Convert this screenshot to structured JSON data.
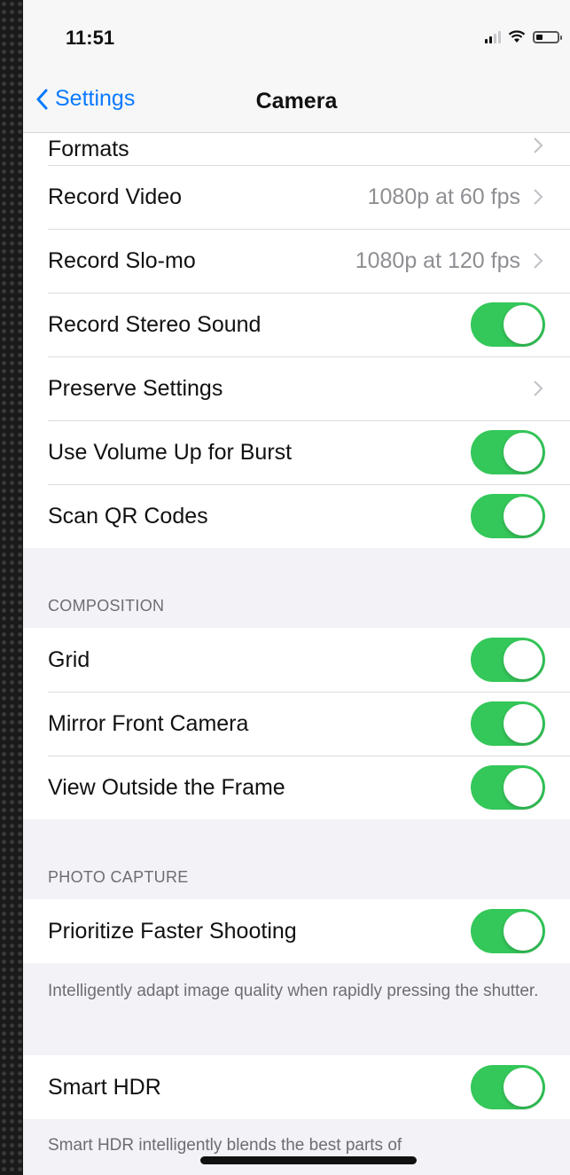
{
  "status_bar": {
    "time": "11:51"
  },
  "nav": {
    "back_label": "Settings",
    "title": "Camera"
  },
  "main_group": [
    {
      "label": "Formats",
      "value": "",
      "control": "chevron"
    },
    {
      "label": "Record Video",
      "value": "1080p at 60 fps",
      "control": "chevron"
    },
    {
      "label": "Record Slo-mo",
      "value": "1080p at 120 fps",
      "control": "chevron"
    },
    {
      "label": "Record Stereo Sound",
      "value": "",
      "control": "toggle",
      "on": true
    },
    {
      "label": "Preserve Settings",
      "value": "",
      "control": "chevron"
    },
    {
      "label": "Use Volume Up for Burst",
      "value": "",
      "control": "toggle",
      "on": true
    },
    {
      "label": "Scan QR Codes",
      "value": "",
      "control": "toggle",
      "on": true
    }
  ],
  "composition": {
    "header": "COMPOSITION",
    "items": [
      {
        "label": "Grid",
        "on": true
      },
      {
        "label": "Mirror Front Camera",
        "on": true
      },
      {
        "label": "View Outside the Frame",
        "on": true
      }
    ]
  },
  "photo_capture": {
    "header": "PHOTO CAPTURE",
    "prioritize_label": "Prioritize Faster Shooting",
    "prioritize_on": true,
    "prioritize_note": "Intelligently adapt image quality when rapidly pressing the shutter.",
    "smart_hdr_label": "Smart HDR",
    "smart_hdr_on": true,
    "smart_hdr_note": "Smart HDR intelligently blends the best parts of"
  },
  "colors": {
    "accent": "#0a7aff",
    "toggle_on": "#34c759",
    "background": "#f2f2f7"
  }
}
